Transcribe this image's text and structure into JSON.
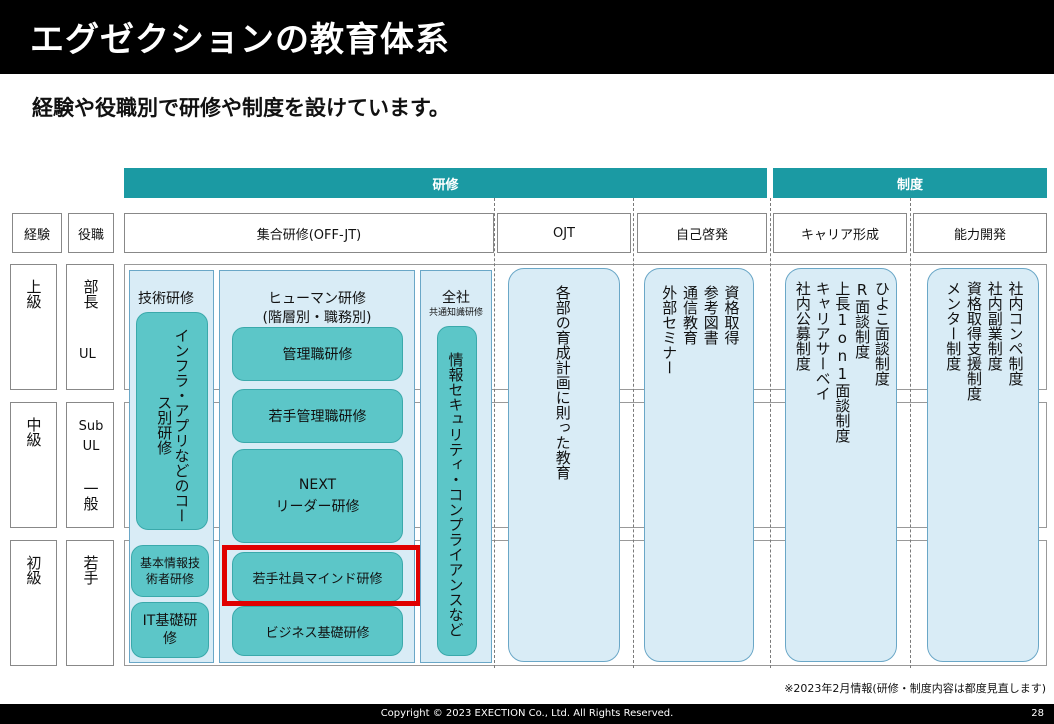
{
  "title": "エグゼクションの教育体系",
  "subtitle": "経験や役職別で研修や制度を設けています。",
  "categories": {
    "training": "研修",
    "system": "制度"
  },
  "headers": {
    "experience": "経験",
    "position": "役職",
    "group_training": "集合研修(OFF-JT)",
    "ojt": "OJT",
    "self_dev": "自己啓発",
    "career": "キャリア形成",
    "ability": "能力開発"
  },
  "levels": [
    {
      "exp": "上級",
      "positions": [
        "部長",
        "UL"
      ]
    },
    {
      "exp": "中級",
      "positions": [
        "Sub UL",
        "一般"
      ]
    },
    {
      "exp": "初級",
      "positions": [
        "若手"
      ]
    }
  ],
  "tech": {
    "title": "技術研修",
    "course": "インフラ・アプリなどのコース別研修",
    "basic_info": "基本情報技術者研修",
    "it_basics": "IT基礎研修"
  },
  "human": {
    "title": "ヒューマン研修",
    "subtitle": "(階層別・職務別)",
    "items": [
      "管理職研修",
      "若手管理職研修",
      "NEXT",
      "リーダー研修",
      "若手社員マインド研修",
      "ビジネス基礎研修"
    ]
  },
  "company": {
    "title": "全社",
    "subtitle": "共通知識研修",
    "content": "情報セキュリティ・コンプライアンスなど"
  },
  "ojt_text": "各部の育成計画に則った教育",
  "self_dev_lines": [
    "資格取得",
    "参考図書",
    "通信教育",
    "外部セミナー"
  ],
  "career_lines": [
    "ひよこ面談制度",
    "R面談制度",
    "上長1on1面談制度",
    "キャリアサーベイ",
    "社内公募制度"
  ],
  "ability_lines": [
    "社内コンペ制度",
    "社内副業制度",
    "資格取得支援制度",
    "メンター制度"
  ],
  "note": "※2023年2月情報(研修・制度内容は都度見直します)",
  "footer": {
    "copyright": "Copyright © 2023 EXECTION Co., Ltd. All Rights Reserved.",
    "page": "28"
  },
  "colors": {
    "teal": "#1b9aa3",
    "pill": "#5cc6c8",
    "panel": "#d9ecf6",
    "highlight": "#e00000"
  }
}
